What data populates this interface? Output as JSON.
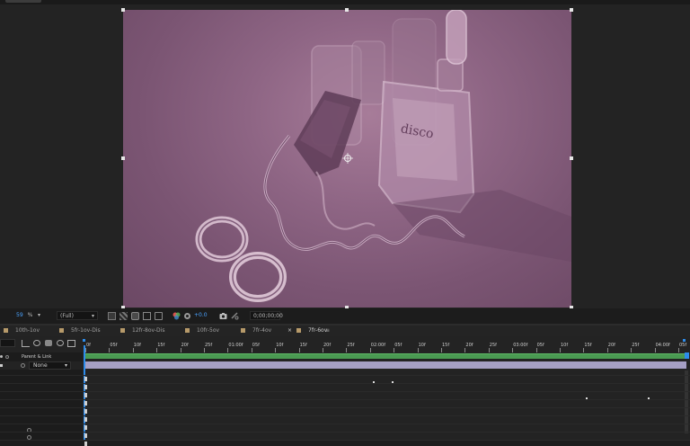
{
  "viewer": {
    "magnification": "59",
    "magnification_unit": "%",
    "resolution": "(Full)",
    "exposure": "+0.0",
    "timecode": "0;00;00;00"
  },
  "tabs": [
    {
      "label": "10th-1ov",
      "active": false
    },
    {
      "label": "5fr-1ov-Dis",
      "active": false
    },
    {
      "label": "12fr-8ov-Dis",
      "active": false
    },
    {
      "label": "10fr-5ov",
      "active": false
    },
    {
      "label": "7fr-4ov",
      "active": false
    },
    {
      "label": "7fr-6ov",
      "active": true
    }
  ],
  "tab_close_glyph": "×",
  "tab_menu_glyph": "≡",
  "layer_panel": {
    "parent_link_header": "Parent & Link",
    "parent_value": "None"
  },
  "ruler": {
    "labels": [
      "0f",
      "05f",
      "10f",
      "15f",
      "20f",
      "25f",
      "01:00f",
      "05f",
      "10f",
      "15f",
      "20f",
      "25f",
      "02:00f",
      "05f",
      "10f",
      "15f",
      "20f",
      "25f",
      "03:00f",
      "05f",
      "10f",
      "15f",
      "20f",
      "25f",
      "04:00f",
      "05f"
    ]
  },
  "colors": {
    "accent": "#2d8ceb",
    "work_area": "#4a9a52",
    "layer_bar": "#a59fc4",
    "tab_swatch": "#b79a6a",
    "canvas_tint": "#8a6180"
  },
  "icons": [
    "roi-icon",
    "transparency-grid-icon",
    "mask-visibility-icon",
    "view-icon",
    "3d-view-icon",
    "color-channel-icon",
    "exposure-icon",
    "camera-snapshot-icon",
    "show-snapshot-icon",
    "parent-pickwhip-icon",
    "solo-icon",
    "motion-blur-icon",
    "graph-editor-icon",
    "eye-icon",
    "lock-icon"
  ]
}
